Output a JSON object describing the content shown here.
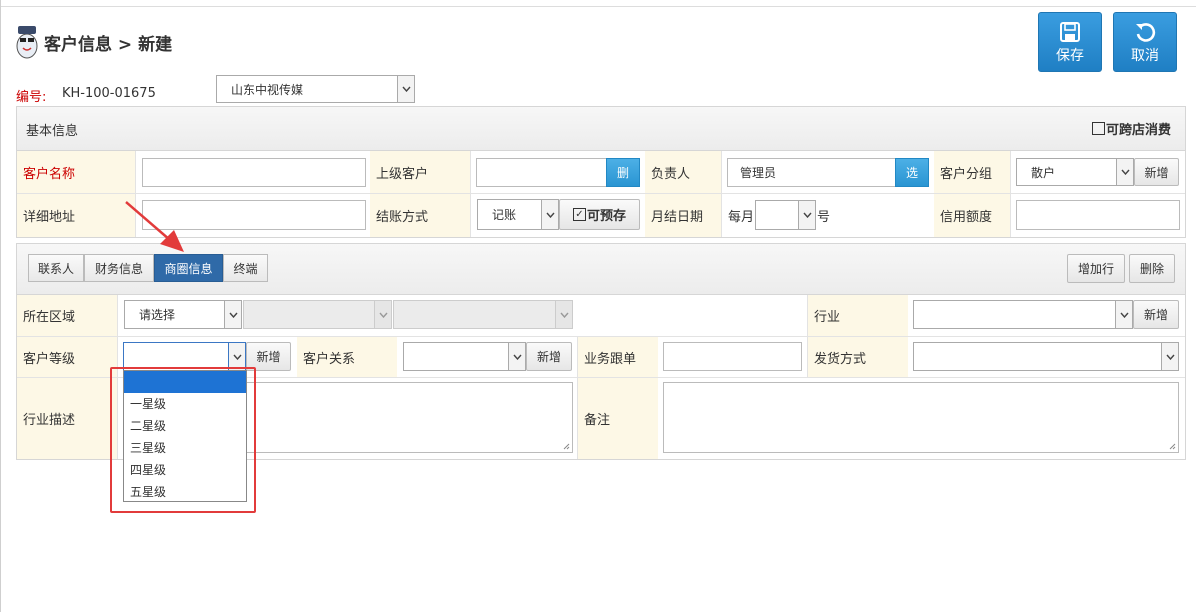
{
  "header": {
    "title": "客户信息 > 新建"
  },
  "toolbar": {
    "save_label": "保存",
    "cancel_label": "取消"
  },
  "code": {
    "label": "编号:",
    "value": "KH-100-01675"
  },
  "store_select": {
    "value": "山东中视传媒"
  },
  "basic": {
    "title": "基本信息",
    "cross_store_label": "可跨店消费",
    "customer_name_label": "客户名称",
    "parent_customer_label": "上级客户",
    "delete_label": "删",
    "owner_label": "负责人",
    "owner_value": "管理员",
    "choose_label": "选",
    "group_label": "客户分组",
    "group_value": "散户",
    "new_label": "新增",
    "address_label": "详细地址",
    "settle_label": "结账方式",
    "settle_value": "记账",
    "prepay_label": "可预存",
    "month_day_label": "月结日期",
    "month_prefix": "每月",
    "day_suffix": "号",
    "credit_label": "信用额度"
  },
  "tabs": {
    "items": [
      "联系人",
      "财务信息",
      "商圈信息",
      "终端"
    ],
    "active": "商圈信息",
    "add_row_label": "增加行",
    "delete_label": "删除"
  },
  "business": {
    "region_label": "所在区域",
    "region_placeholder": "请选择",
    "industry_label": "行业",
    "new_label": "新增",
    "level_label": "客户等级",
    "relation_label": "客户关系",
    "follow_label": "业务跟单",
    "shipping_label": "发货方式",
    "industry_desc_label": "行业描述",
    "note_label": "备注"
  },
  "level_dropdown": {
    "options": [
      "",
      "一星级",
      "二星级",
      "三星级",
      "四星级",
      "五星级"
    ],
    "selected_index": 0
  },
  "colors": {
    "accent": "#2a8fd6",
    "active_tab": "#2f6aa8",
    "label_bg": "#fdf8e6",
    "highlight_box": "#e23b3b",
    "arrow": "#e23b3b"
  }
}
